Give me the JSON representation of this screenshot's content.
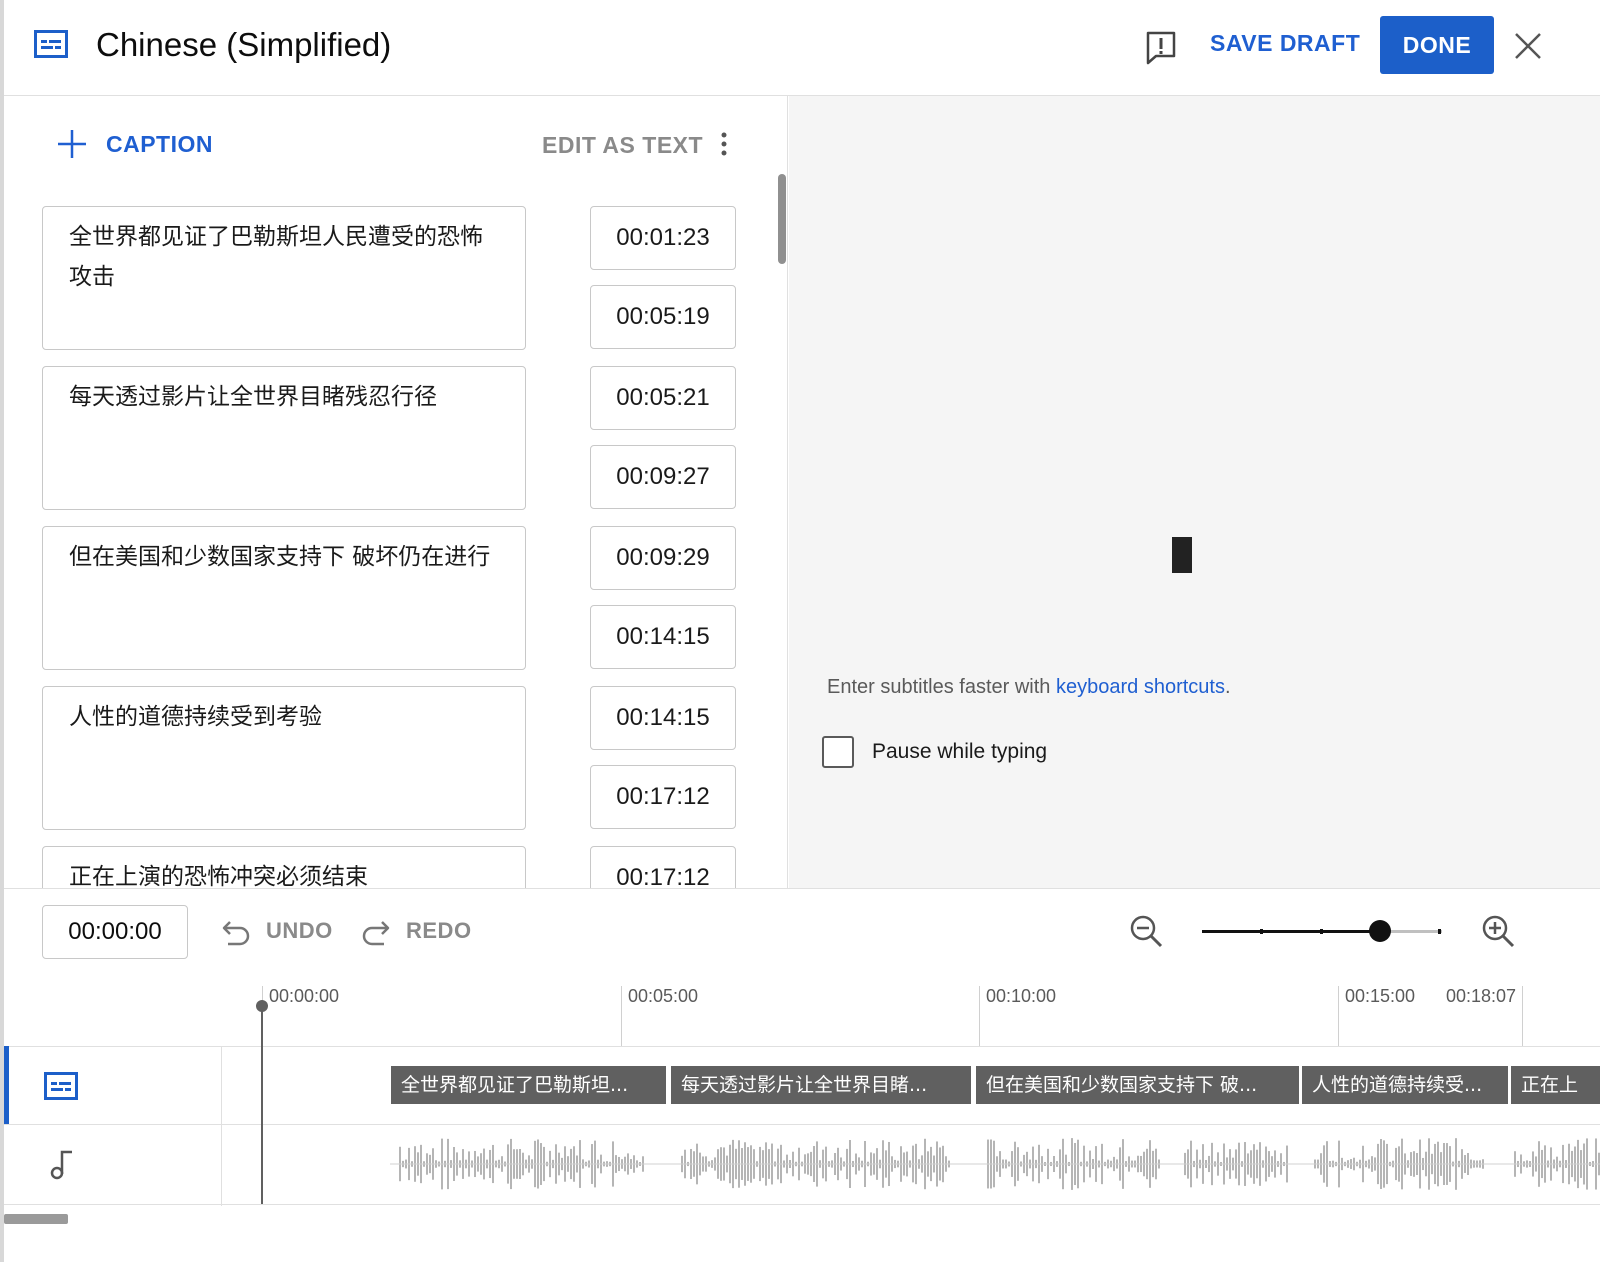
{
  "header": {
    "title": "Chinese (Simplified)",
    "save_draft": "SAVE DRAFT",
    "done": "DONE"
  },
  "editor": {
    "add_caption": "CAPTION",
    "edit_as_text": "EDIT AS TEXT",
    "captions": [
      {
        "text": "全世界都见证了巴勒斯坦人民遭受的恐怖攻击",
        "start": "00:01:23",
        "end": "00:05:19"
      },
      {
        "text": "每天透过影片让全世界目睹残忍行径",
        "start": "00:05:21",
        "end": "00:09:27"
      },
      {
        "text": "但在美国和少数国家支持下 破坏仍在进行",
        "start": "00:09:29",
        "end": "00:14:15"
      },
      {
        "text": "人性的道德持续受到考验",
        "start": "00:14:15",
        "end": "00:17:12"
      },
      {
        "text": "正在上演的恐怖冲突必须结束",
        "start": "00:17:12",
        "end": ""
      }
    ]
  },
  "preview": {
    "hint_prefix": "Enter subtitles faster with ",
    "hint_link": "keyboard shortcuts",
    "hint_suffix": ".",
    "pause_label": "Pause while typing",
    "pause_checked": false
  },
  "toolbar": {
    "current_time": "00:00:00",
    "undo": "UNDO",
    "redo": "REDO",
    "zoom_level": 0.74
  },
  "timeline": {
    "ticks": [
      "00:00:00",
      "00:05:00",
      "00:10:00",
      "00:15:00",
      "00:18:07"
    ],
    "clips": [
      "全世界都见证了巴勒斯坦...",
      "每天透过影片让全世界目睹...",
      "但在美国和少数国家支持下 破...",
      "人性的道德持续受...",
      "正在上"
    ]
  },
  "colors": {
    "accent": "#1c5fc9",
    "link": "#1f5fd1",
    "clip_bg": "#606060"
  }
}
